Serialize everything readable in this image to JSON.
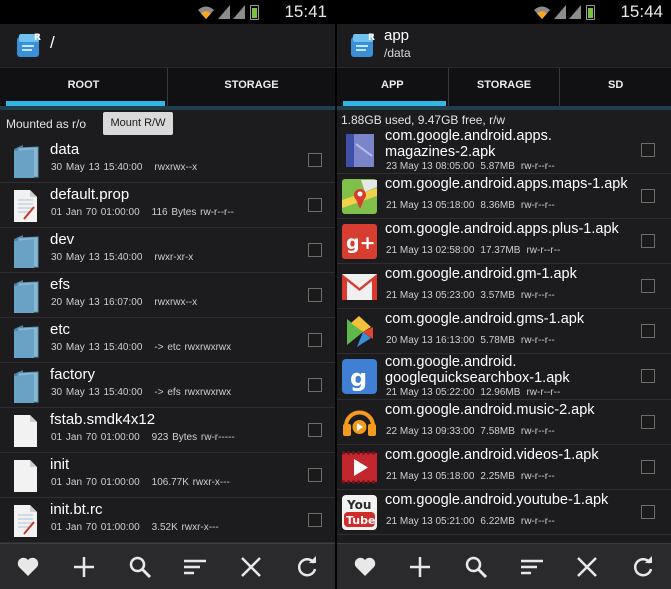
{
  "status": {
    "left_time": "15:41",
    "right_time": "15:44"
  },
  "left": {
    "title": "/",
    "tabs": [
      {
        "label": "ROOT"
      },
      {
        "label": "STORAGE"
      }
    ],
    "mount_label": "Mounted as r/o",
    "mount_button": "Mount R/W",
    "files": [
      {
        "name": "data",
        "date": "30 May 13 15:40:00",
        "extra": "rwxrwx--x",
        "type": "folder"
      },
      {
        "name": "default.prop",
        "date": "01 Jan 70 01:00:00",
        "extra": "116 Bytes  rw-r--r--",
        "type": "prop"
      },
      {
        "name": "dev",
        "date": "30 May 13 15:40:00",
        "extra": "rwxr-xr-x",
        "type": "folder"
      },
      {
        "name": "efs",
        "date": "20 May 13 16:07:00",
        "extra": "rwxrwx--x",
        "type": "folder"
      },
      {
        "name": "etc",
        "date": "30 May 13 15:40:00",
        "extra": "-> etc  rwxrwxrwx",
        "type": "folder"
      },
      {
        "name": "factory",
        "date": "30 May 13 15:40:00",
        "extra": "-> efs  rwxrwxrwx",
        "type": "folder"
      },
      {
        "name": "fstab.smdk4x12",
        "date": "01 Jan 70 01:00:00",
        "extra": "923 Bytes  rw-r-----",
        "type": "file"
      },
      {
        "name": "init",
        "date": "01 Jan 70 01:00:00",
        "extra": "106.77K  rwxr-x---",
        "type": "file"
      },
      {
        "name": "init.bt.rc",
        "date": "01 Jan 70 01:00:00",
        "extra": "3.52K  rwxr-x---",
        "type": "prop"
      }
    ]
  },
  "right": {
    "title": "app",
    "subtitle": "/data",
    "tabs": [
      {
        "label": "APP"
      },
      {
        "label": "STORAGE"
      },
      {
        "label": "SD"
      }
    ],
    "storage_info": "1.88GB used, 9.47GB free, r/w",
    "apps": [
      {
        "line1": "com.google.android.apps.",
        "line2": "magazines-2.apk",
        "date": "23 May 13 08:05:00",
        "size": "5.87MB",
        "perm": "rw-r--r--",
        "icon": "magazines-icon"
      },
      {
        "line1": "com.google.android.apps.maps-1.apk",
        "line2": "",
        "date": "21 May 13 05:18:00",
        "size": "8.36MB",
        "perm": "rw-r--r--",
        "icon": "maps-icon"
      },
      {
        "line1": "com.google.android.apps.plus-1.apk",
        "line2": "",
        "date": "21 May 13 02:58:00",
        "size": "17.37MB",
        "perm": "rw-r--r--",
        "icon": "gplus-icon"
      },
      {
        "line1": "com.google.android.gm-1.apk",
        "line2": "",
        "date": "21 May 13 05:23:00",
        "size": "3.57MB",
        "perm": "rw-r--r--",
        "icon": "gmail-icon"
      },
      {
        "line1": "com.google.android.gms-1.apk",
        "line2": "",
        "date": "20 May 13 16:13:00",
        "size": "5.78MB",
        "perm": "rw-r--r--",
        "icon": "play-services-icon"
      },
      {
        "line1": "com.google.android.",
        "line2": "googlequicksearchbox-1.apk",
        "date": "21 May 13 05:22:00",
        "size": "12.96MB",
        "perm": "rw-r--r--",
        "icon": "google-search-icon"
      },
      {
        "line1": "com.google.android.music-2.apk",
        "line2": "",
        "date": "22 May 13 09:33:00",
        "size": "7.58MB",
        "perm": "rw-r--r--",
        "icon": "play-music-icon"
      },
      {
        "line1": "com.google.android.videos-1.apk",
        "line2": "",
        "date": "21 May 13 05:18:00",
        "size": "2.25MB",
        "perm": "rw-r--r--",
        "icon": "play-movies-icon"
      },
      {
        "line1": "com.google.android.youtube-1.apk",
        "line2": "",
        "date": "21 May 13 05:21:00",
        "size": "6.22MB",
        "perm": "rw-r--r--",
        "icon": "youtube-icon",
        "icon_text_top": "You",
        "icon_text_bottom": "Tube"
      }
    ]
  },
  "toolbar": [
    "heart-icon",
    "plus-icon",
    "search-icon",
    "sort-icon",
    "close-icon",
    "refresh-icon"
  ],
  "colors": {
    "accent": "#33b5e5",
    "background": "#1c1c1e",
    "bottombar": "#2a2a2c"
  }
}
